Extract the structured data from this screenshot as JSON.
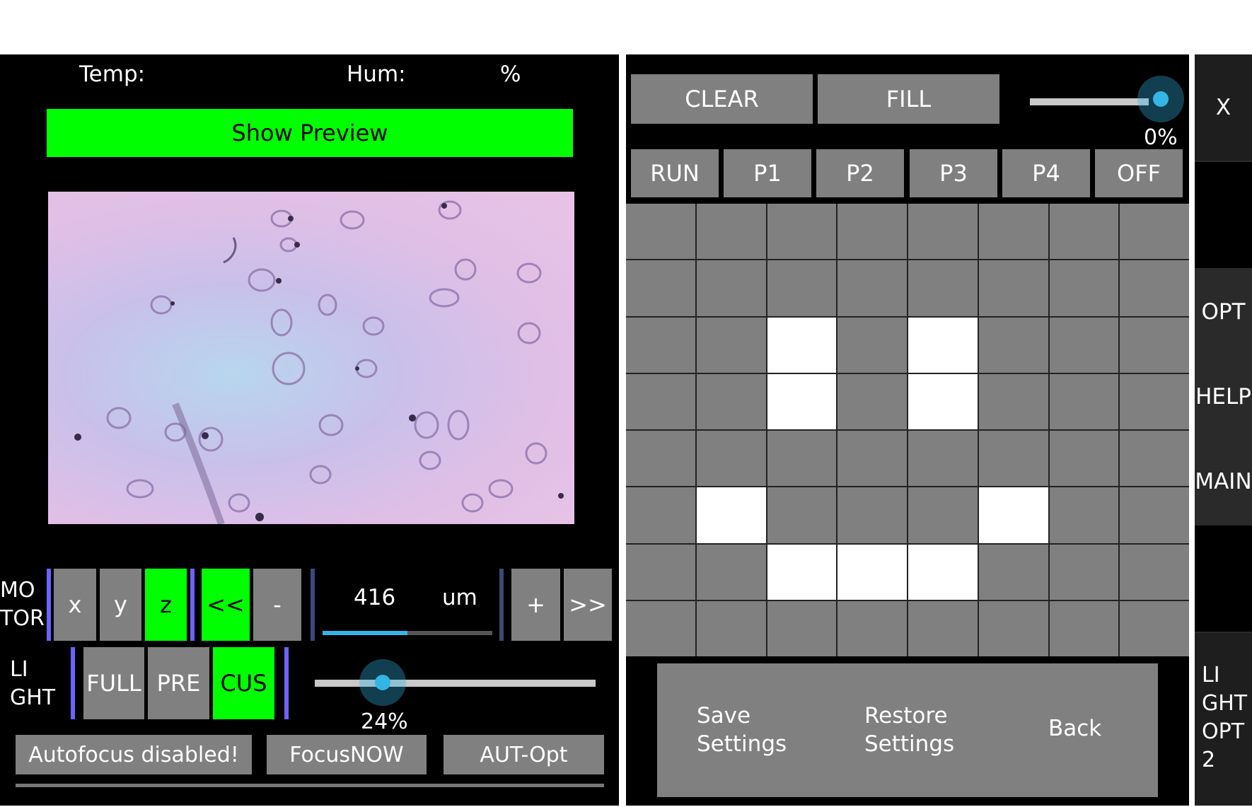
{
  "status": {
    "temp_label": "Temp:",
    "hum_label": "Hum:",
    "hum_unit": "%"
  },
  "preview": {
    "button_label": "Show Preview"
  },
  "motor": {
    "label_line1": "MO",
    "label_line2": "TOR",
    "axis_buttons": [
      "x",
      "y",
      "z"
    ],
    "active_axis": "z",
    "step_back_fast": "<<",
    "step_back": "-",
    "position_value": "416",
    "position_unit": "um",
    "step_forward": "+",
    "step_forward_fast": ">>",
    "position_slider_level": 0.5
  },
  "light": {
    "label_line1": "LI",
    "label_line2": "GHT",
    "modes": [
      "FULL",
      "PRE",
      "CUS"
    ],
    "active_mode": "CUS",
    "intensity_text": "24%",
    "intensity_level": 0.24
  },
  "focus": {
    "autofocus_label": "Autofocus disabled!",
    "focus_now_label": "FocusNOW",
    "aut_opt_label": "AUT-Opt"
  },
  "led_matrix": {
    "clear_label": "CLEAR",
    "fill_label": "FILL",
    "brightness_text": "0%",
    "brightness_level": 1.0,
    "pattern_buttons": [
      "RUN",
      "P1",
      "P2",
      "P3",
      "P4",
      "OFF"
    ],
    "rows": 8,
    "cols": 8,
    "lit_cells": [
      [
        2,
        2
      ],
      [
        2,
        4
      ],
      [
        3,
        2
      ],
      [
        3,
        4
      ],
      [
        5,
        1
      ],
      [
        5,
        5
      ],
      [
        6,
        2
      ],
      [
        6,
        3
      ],
      [
        6,
        4
      ]
    ]
  },
  "settings": {
    "save_line1": "Save",
    "save_line2": "Settings",
    "restore_line1": "Restore",
    "restore_line2": "Settings",
    "back_label": "Back"
  },
  "sidebar": {
    "close_label": "X",
    "opt_label": "OPT",
    "help_label": "HELP",
    "main_label": "MAIN",
    "light_opt_lines": [
      "LI",
      "GHT",
      "OPT",
      "2"
    ]
  },
  "colors": {
    "active_green": "#00ff00",
    "button_gray": "#808080",
    "accent_blue": "#33b5e5",
    "divider_purple": "#6c63ff"
  }
}
